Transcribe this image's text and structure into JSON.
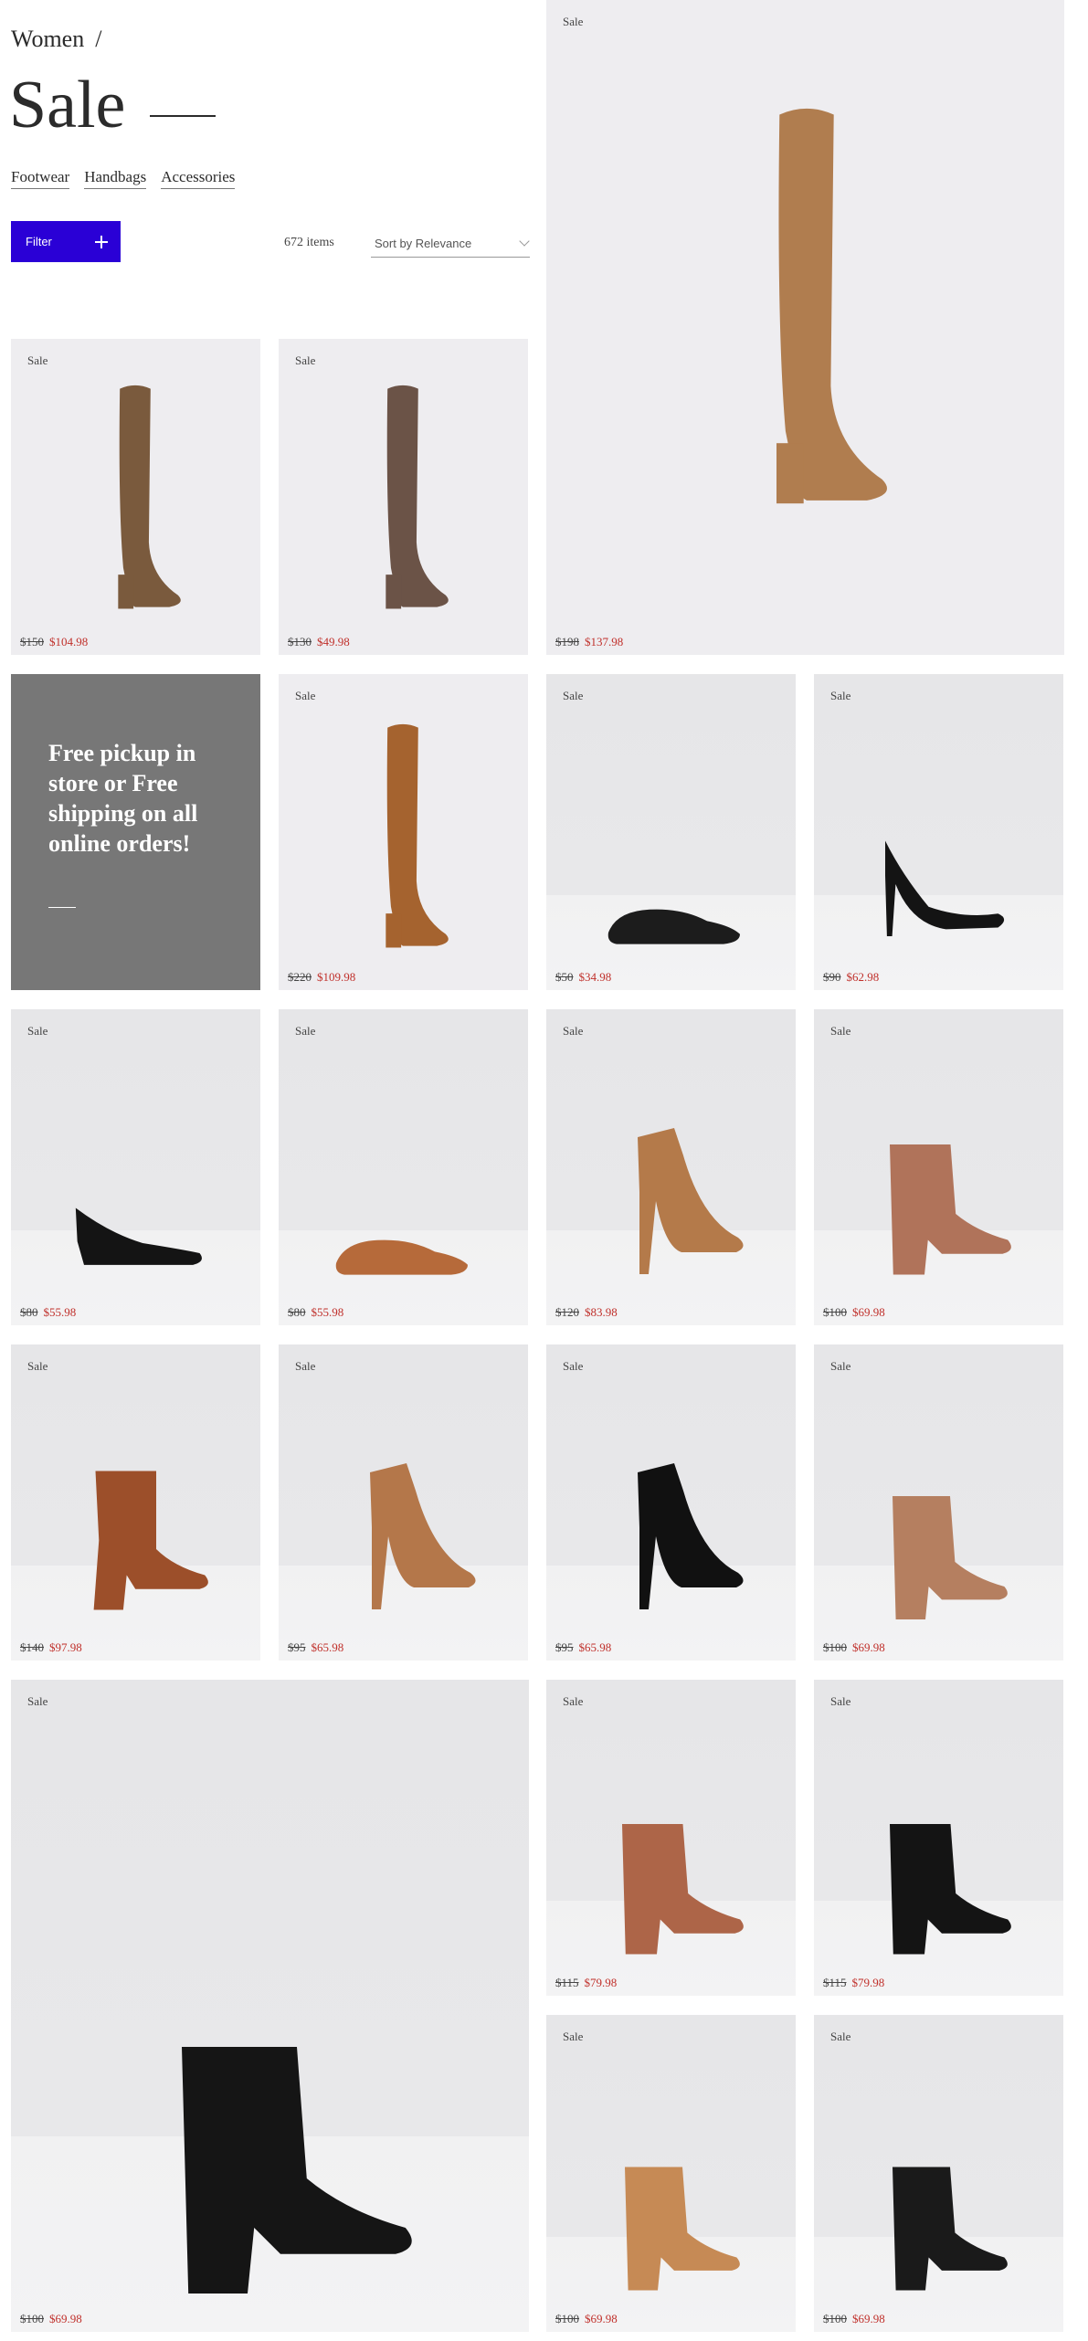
{
  "breadcrumb": {
    "label": "Women",
    "separator": "/"
  },
  "page": {
    "title": "Sale"
  },
  "tabs": [
    {
      "label": "Footwear"
    },
    {
      "label": "Handbags"
    },
    {
      "label": "Accessories"
    }
  ],
  "filter": {
    "label": "Filter"
  },
  "results": {
    "count": "672 items"
  },
  "sort": {
    "value": "Sort by Relevance"
  },
  "promo": {
    "text": "Free pickup in store or Free shipping on all online orders!"
  },
  "colors": {
    "accent": "#2a00d6",
    "sale_price": "#c0302b",
    "promo_bg": "#777777"
  },
  "products": [
    {
      "badge": "Sale",
      "original": "$150",
      "sale": "$104.98",
      "icon": "over-the-knee-boot-icon"
    },
    {
      "badge": "Sale",
      "original": "$130",
      "sale": "$49.98",
      "icon": "over-the-knee-boot-icon"
    },
    {
      "badge": "Sale",
      "original": "$198",
      "sale": "$137.98",
      "icon": "over-the-knee-boot-icon"
    },
    {
      "badge": "Sale",
      "original": "$220",
      "sale": "$109.98",
      "icon": "over-the-knee-boot-icon"
    },
    {
      "badge": "Sale",
      "original": "$50",
      "sale": "$34.98",
      "icon": "tassel-loafer-icon"
    },
    {
      "badge": "Sale",
      "original": "$90",
      "sale": "$62.98",
      "icon": "pump-icon"
    },
    {
      "badge": "Sale",
      "original": "$80",
      "sale": "$55.98",
      "icon": "wedge-pump-icon"
    },
    {
      "badge": "Sale",
      "original": "$80",
      "sale": "$55.98",
      "icon": "loafer-icon"
    },
    {
      "badge": "Sale",
      "original": "$120",
      "sale": "$83.98",
      "icon": "platform-lace-up-heel-icon"
    },
    {
      "badge": "Sale",
      "original": "$100",
      "sale": "$69.98",
      "icon": "ankle-strap-heel-icon"
    },
    {
      "badge": "Sale",
      "original": "$140",
      "sale": "$97.98",
      "icon": "ankle-boot-icon"
    },
    {
      "badge": "Sale",
      "original": "$95",
      "sale": "$65.98",
      "icon": "perforated-heel-icon"
    },
    {
      "badge": "Sale",
      "original": "$95",
      "sale": "$65.98",
      "icon": "perforated-heel-icon"
    },
    {
      "badge": "Sale",
      "original": "$100",
      "sale": "$69.98",
      "icon": "mule-icon"
    },
    {
      "badge": "Sale",
      "original": "$100",
      "sale": "$69.98",
      "icon": "perforated-mule-icon"
    },
    {
      "badge": "Sale",
      "original": "$115",
      "sale": "$79.98",
      "icon": "slingback-heel-icon"
    },
    {
      "badge": "Sale",
      "original": "$115",
      "sale": "$79.98",
      "icon": "slingback-heel-icon"
    },
    {
      "badge": "Sale",
      "original": "$100",
      "sale": "$69.98",
      "icon": "caged-sandal-icon"
    },
    {
      "badge": "Sale",
      "original": "$100",
      "sale": "$69.98",
      "icon": "caged-sandal-icon"
    }
  ]
}
